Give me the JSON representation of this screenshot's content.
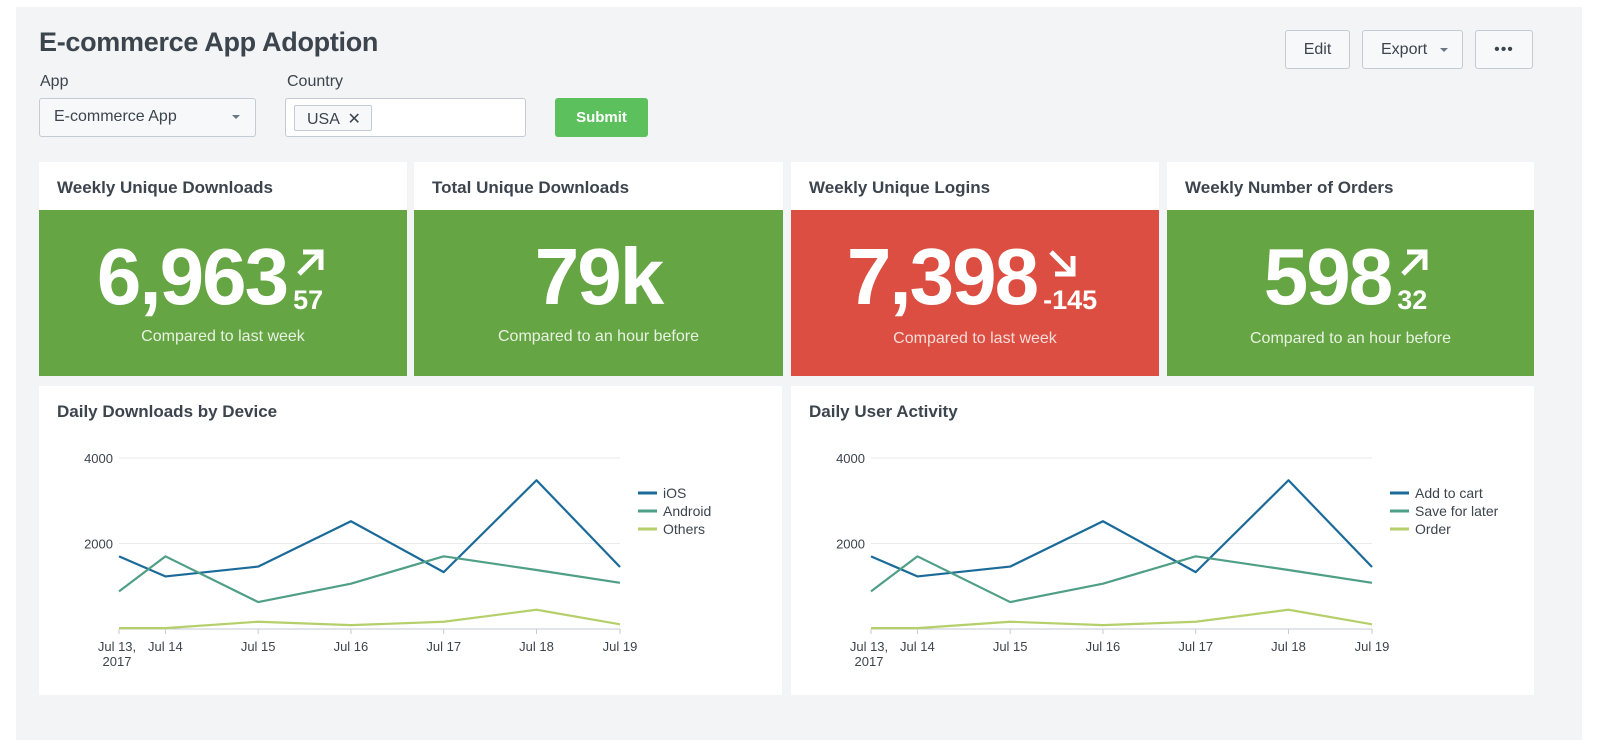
{
  "header": {
    "title": "E-commerce App Adoption",
    "edit_label": "Edit",
    "export_label": "Export",
    "more_label": "•••"
  },
  "filters": {
    "app_label": "App",
    "app_value": "E-commerce App",
    "country_label": "Country",
    "country_chip": "USA",
    "submit_label": "Submit"
  },
  "kpis": [
    {
      "title": "Weekly Unique Downloads",
      "value": "6,963",
      "delta": "57",
      "trend": "up",
      "sub": "Compared to last week",
      "color": "#65a543"
    },
    {
      "title": "Total Unique Downloads",
      "value": "79k",
      "delta": "",
      "trend": "none",
      "sub": "Compared to an hour before",
      "color": "#65a543"
    },
    {
      "title": "Weekly Unique Logins",
      "value": "7,398",
      "delta": "-145",
      "trend": "down",
      "sub": "Compared to last week",
      "color": "#dc4e41"
    },
    {
      "title": "Weekly Number of Orders",
      "value": "598",
      "delta": "32",
      "trend": "up",
      "sub": "Compared to an hour before",
      "color": "#65a543"
    }
  ],
  "charts": [
    {
      "title": "Daily Downloads by Device"
    },
    {
      "title": "Daily User Activity"
    }
  ],
  "chart_data": [
    {
      "type": "line",
      "title": "Daily Downloads by Device",
      "x": [
        "Jul 13, 2017",
        "Jul 14",
        "Jul 15",
        "Jul 16",
        "Jul 17",
        "Jul 18",
        "Jul 19"
      ],
      "x_tick_lines": [
        [
          "Jul 13,",
          "2017"
        ],
        [
          "Jul 14"
        ],
        [
          "Jul 15"
        ],
        [
          "Jul 16"
        ],
        [
          "Jul 17"
        ],
        [
          "Jul 18"
        ],
        [
          "Jul 19"
        ]
      ],
      "x_days": [
        0,
        0.5,
        1.5,
        2.5,
        3.5,
        4.5,
        5.4
      ],
      "ylim": [
        0,
        4000
      ],
      "yticks": [
        2000,
        4000
      ],
      "legend_position": "right",
      "grid": true,
      "series": [
        {
          "name": "iOS",
          "color": "#1a6a9a",
          "points": [
            [
              0,
              1700
            ],
            [
              0.5,
              1230
            ],
            [
              1.5,
              1460
            ],
            [
              2.5,
              2520
            ],
            [
              3.5,
              1330
            ],
            [
              4.5,
              3480
            ],
            [
              5.4,
              1450
            ]
          ]
        },
        {
          "name": "Android",
          "color": "#4f9e86",
          "points": [
            [
              0,
              880
            ],
            [
              0.5,
              1700
            ],
            [
              1.5,
              630
            ],
            [
              2.5,
              1060
            ],
            [
              3.5,
              1700
            ],
            [
              4.5,
              1380
            ],
            [
              5.4,
              1080
            ]
          ]
        },
        {
          "name": "Others",
          "color": "#b5cf6b",
          "points": [
            [
              0,
              20
            ],
            [
              0.5,
              20
            ],
            [
              1.5,
              170
            ],
            [
              2.5,
              90
            ],
            [
              3.5,
              170
            ],
            [
              4.5,
              450
            ],
            [
              5.4,
              110
            ]
          ]
        }
      ]
    },
    {
      "type": "line",
      "title": "Daily User Activity",
      "x": [
        "Jul 13, 2017",
        "Jul 14",
        "Jul 15",
        "Jul 16",
        "Jul 17",
        "Jul 18",
        "Jul 19"
      ],
      "x_tick_lines": [
        [
          "Jul 13,",
          "2017"
        ],
        [
          "Jul 14"
        ],
        [
          "Jul 15"
        ],
        [
          "Jul 16"
        ],
        [
          "Jul 17"
        ],
        [
          "Jul 18"
        ],
        [
          "Jul 19"
        ]
      ],
      "x_days": [
        0,
        0.5,
        1.5,
        2.5,
        3.5,
        4.5,
        5.4
      ],
      "ylim": [
        0,
        4000
      ],
      "yticks": [
        2000,
        4000
      ],
      "legend_position": "right",
      "grid": true,
      "series": [
        {
          "name": "Add to cart",
          "color": "#1a6a9a",
          "points": [
            [
              0,
              1700
            ],
            [
              0.5,
              1230
            ],
            [
              1.5,
              1460
            ],
            [
              2.5,
              2520
            ],
            [
              3.5,
              1330
            ],
            [
              4.5,
              3480
            ],
            [
              5.4,
              1450
            ]
          ]
        },
        {
          "name": "Save for later",
          "color": "#4f9e86",
          "points": [
            [
              0,
              880
            ],
            [
              0.5,
              1700
            ],
            [
              1.5,
              630
            ],
            [
              2.5,
              1060
            ],
            [
              3.5,
              1700
            ],
            [
              4.5,
              1380
            ],
            [
              5.4,
              1080
            ]
          ]
        },
        {
          "name": "Order",
          "color": "#b5cf6b",
          "points": [
            [
              0,
              20
            ],
            [
              0.5,
              20
            ],
            [
              1.5,
              170
            ],
            [
              2.5,
              90
            ],
            [
              3.5,
              170
            ],
            [
              4.5,
              450
            ],
            [
              5.4,
              110
            ]
          ]
        }
      ]
    }
  ]
}
